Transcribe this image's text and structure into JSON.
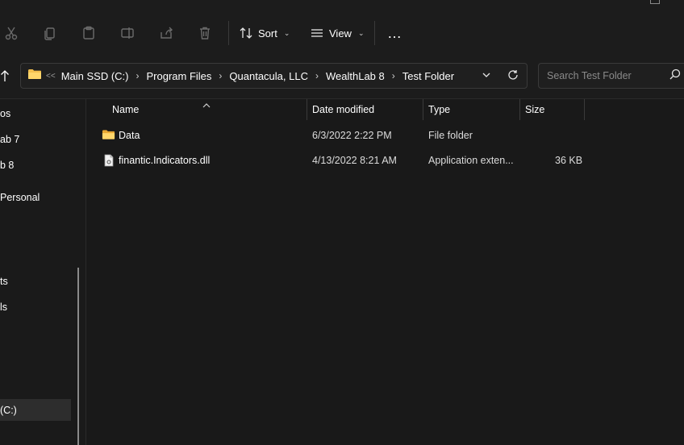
{
  "toolbar": {
    "icons": [
      "cut-icon",
      "copy-icon",
      "paste-icon",
      "rename-icon",
      "share-icon",
      "delete-icon"
    ],
    "sort_label": "Sort",
    "view_label": "View",
    "more_label": "…"
  },
  "address": {
    "overflow": "<<",
    "crumbs": [
      "Main SSD (C:)",
      "Program Files",
      "Quantacula, LLC",
      "WealthLab 8",
      "Test Folder"
    ]
  },
  "search": {
    "placeholder": "Search Test Folder"
  },
  "sidebar": {
    "items": [
      "os",
      "ab 7",
      "b 8",
      "Personal",
      "ts",
      "ls",
      "(C:)"
    ]
  },
  "columns": {
    "name": "Name",
    "date": "Date modified",
    "type": "Type",
    "size": "Size"
  },
  "files": [
    {
      "name": "Data",
      "date": "6/3/2022 2:22 PM",
      "type": "File folder",
      "size": "",
      "icon": "folder-icon"
    },
    {
      "name": "finantic.Indicators.dll",
      "date": "4/13/2022 8:21 AM",
      "type": "Application exten...",
      "size": "36 KB",
      "icon": "dll-file-icon"
    }
  ],
  "colors": {
    "background": "#191919",
    "folder": "#f4c04f",
    "selected": "#2d2d2d"
  }
}
